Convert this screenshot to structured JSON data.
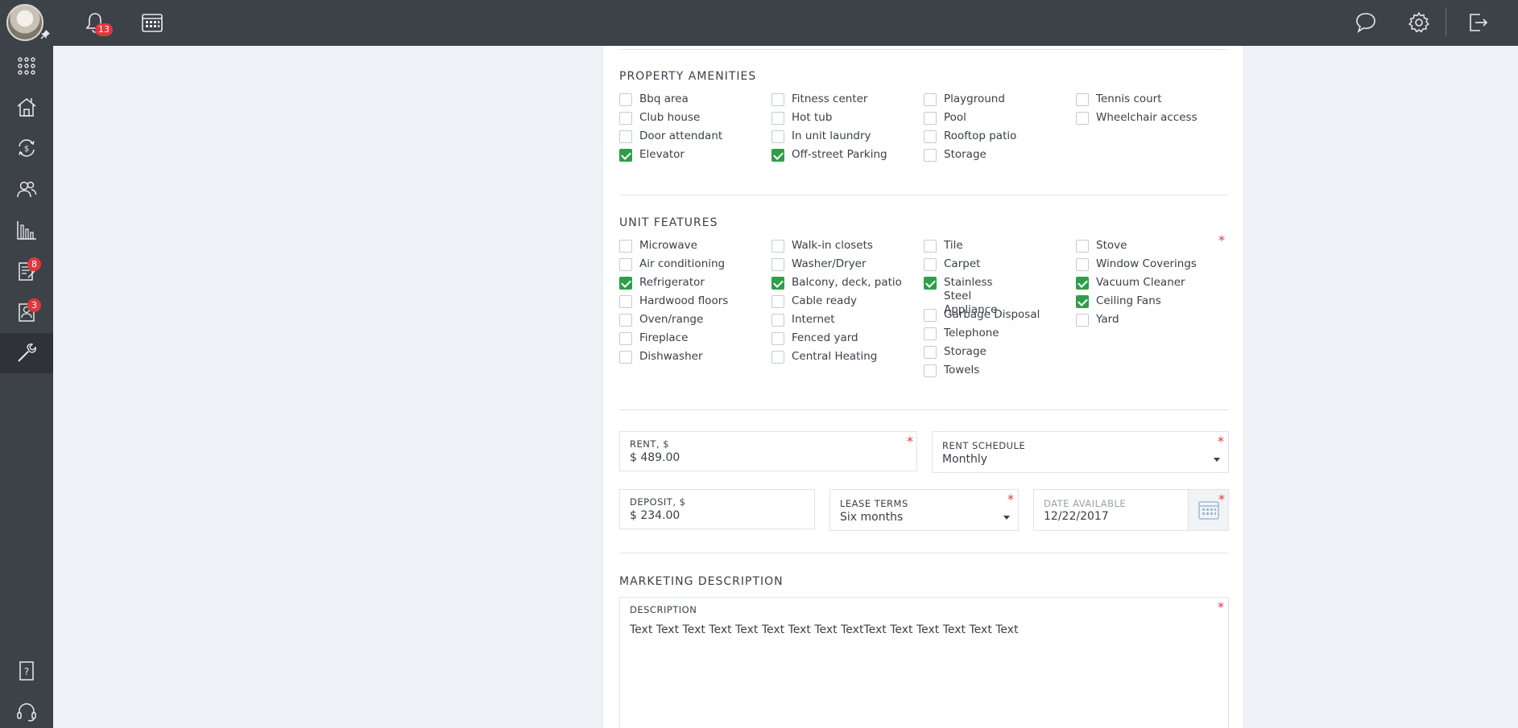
{
  "topbar": {
    "notifications_count": "13",
    "icons": [
      "bell-icon",
      "calendar-icon",
      "chat-icon",
      "gear-icon",
      "logout-icon"
    ]
  },
  "sidebar": {
    "items": [
      {
        "icon": "apps-grid-icon"
      },
      {
        "icon": "properties-icon"
      },
      {
        "icon": "payments-icon"
      },
      {
        "icon": "people-icon"
      },
      {
        "icon": "reports-chart-icon"
      },
      {
        "icon": "applications-icon",
        "badge": "8"
      },
      {
        "icon": "tenant-screening-icon",
        "badge": "3"
      },
      {
        "icon": "tools-icon",
        "active": true
      },
      {
        "icon": "help-icon"
      },
      {
        "icon": "support-headset-icon"
      }
    ]
  },
  "amenities": {
    "title": "PROPERTY AMENITIES",
    "col1": [
      {
        "label": "Bbq area",
        "checked": false
      },
      {
        "label": "Club house",
        "checked": false
      },
      {
        "label": "Door attendant",
        "checked": false
      },
      {
        "label": "Elevator",
        "checked": true
      }
    ],
    "col2": [
      {
        "label": "Fitness center",
        "checked": false
      },
      {
        "label": "Hot tub",
        "checked": false
      },
      {
        "label": "In unit laundry",
        "checked": false
      },
      {
        "label": "Off-street Parking",
        "checked": true
      }
    ],
    "col3": [
      {
        "label": "Playground",
        "checked": false
      },
      {
        "label": "Pool",
        "checked": false
      },
      {
        "label": "Rooftop patio",
        "checked": false
      },
      {
        "label": "Storage",
        "checked": false
      }
    ],
    "col4": [
      {
        "label": "Tennis court",
        "checked": false
      },
      {
        "label": "Wheelchair access",
        "checked": false
      }
    ]
  },
  "features": {
    "title": "UNIT FEATURES",
    "required_mark": "*",
    "col1": [
      {
        "label": "Microwave",
        "checked": false
      },
      {
        "label": "Air conditioning",
        "checked": false
      },
      {
        "label": "Refrigerator",
        "checked": true
      },
      {
        "label": "Hardwood floors",
        "checked": false
      },
      {
        "label": "Oven/range",
        "checked": false
      },
      {
        "label": "Fireplace",
        "checked": false
      },
      {
        "label": "Dishwasher",
        "checked": false
      }
    ],
    "col2": [
      {
        "label": "Walk-in closets",
        "checked": false
      },
      {
        "label": "Washer/Dryer",
        "checked": false
      },
      {
        "label": "Balcony, deck, patio",
        "checked": true
      },
      {
        "label": "Cable ready",
        "checked": false
      },
      {
        "label": "Internet",
        "checked": false
      },
      {
        "label": "Fenced yard",
        "checked": false
      },
      {
        "label": "Central Heating",
        "checked": false
      }
    ],
    "col3": [
      {
        "label": "Tile",
        "checked": false
      },
      {
        "label": "Carpet",
        "checked": false
      },
      {
        "label": "Stainless Steel Appliance",
        "checked": true
      },
      {
        "label": "Garbage Disposal",
        "checked": false
      },
      {
        "label": "Telephone",
        "checked": false
      },
      {
        "label": "Storage",
        "checked": false
      },
      {
        "label": "Towels",
        "checked": false
      }
    ],
    "col4": [
      {
        "label": "Stove",
        "checked": false
      },
      {
        "label": "Window Coverings",
        "checked": false
      },
      {
        "label": "Vacuum Cleaner",
        "checked": true
      },
      {
        "label": "Ceiling Fans",
        "checked": true
      },
      {
        "label": "Yard",
        "checked": false
      }
    ]
  },
  "rent": {
    "label": "RENT, $",
    "value": "$ 489.00",
    "required_mark": "*"
  },
  "rent_schedule": {
    "label": "RENT SCHEDULE",
    "value": "Monthly",
    "required_mark": "*"
  },
  "deposit": {
    "label": "DEPOSIT, $",
    "value": "$ 234.00"
  },
  "lease_terms": {
    "label": "LEASE TERMS",
    "value": "Six months",
    "required_mark": "*"
  },
  "date_available": {
    "label": "DATE AVAILABLE",
    "value": "12/22/2017",
    "required_mark": "*"
  },
  "marketing": {
    "title": "MARKETING DESCRIPTION",
    "description_label": "DESCRIPTION",
    "description_text": "Text Text Text Text Text Text Text Text TextText Text Text Text Text Text",
    "required_mark": "*"
  },
  "colors": {
    "accent_check": "#2f9e4a",
    "badge": "#e0373d",
    "chrome": "#3d4249"
  }
}
